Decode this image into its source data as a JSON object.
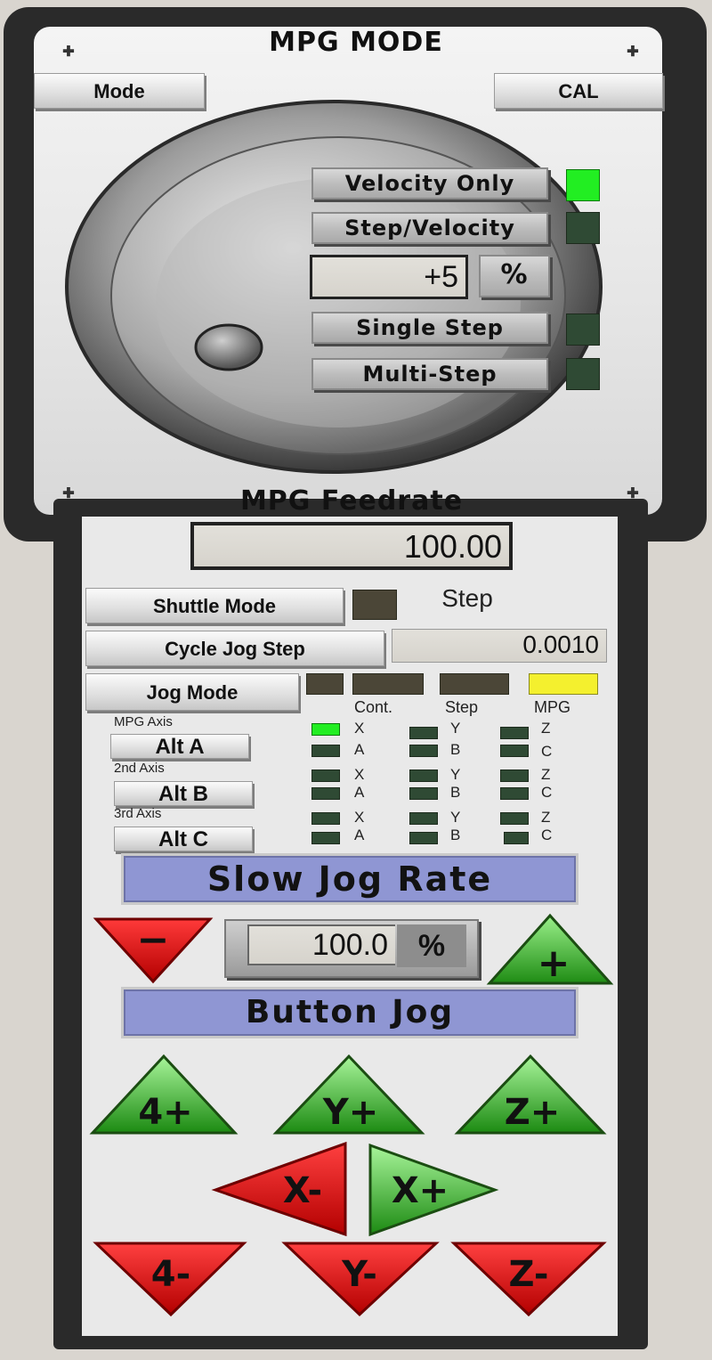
{
  "header": {
    "title": "MPG MODE",
    "mode_button": "Mode",
    "cal_button": "CAL"
  },
  "mpg_modes": [
    {
      "label": "Velocity Only",
      "active": true
    },
    {
      "label": "Step/Velocity",
      "active": false
    },
    {
      "label": "Single Step",
      "active": false
    },
    {
      "label": "Multi-Step",
      "active": false
    }
  ],
  "mpg_percent": {
    "value": "+5",
    "unit": "%"
  },
  "feedrate": {
    "title": "MPG Feedrate",
    "value": "100.00"
  },
  "shuttle": {
    "label": "Shuttle Mode",
    "status": "Step"
  },
  "jog_step": {
    "label": "Cycle Jog Step",
    "value": "0.0010"
  },
  "jog_mode": {
    "label": "Jog Mode",
    "columns": [
      "Cont.",
      "Step",
      "MPG"
    ],
    "active_column": "MPG",
    "colors": {
      "inactive": "#4b4637",
      "active": "#f4f02e"
    }
  },
  "axes": {
    "titles": [
      "MPG Axis",
      "2nd Axis",
      "3rd Axis"
    ],
    "alt_buttons": [
      "Alt A",
      "Alt B",
      "Alt C"
    ],
    "rows": [
      {
        "labels": [
          "X",
          "A",
          "Y",
          "B",
          "Z",
          "C"
        ],
        "active": "X"
      },
      {
        "labels": [
          "X",
          "A",
          "Y",
          "B",
          "Z",
          "C"
        ],
        "active": ""
      },
      {
        "labels": [
          "X",
          "A",
          "Y",
          "B",
          "Z",
          "C"
        ],
        "active": ""
      }
    ]
  },
  "slow_jog": {
    "title": "Slow Jog Rate",
    "value": "100.0",
    "unit": "%",
    "minus": "−",
    "plus": "+"
  },
  "button_jog": {
    "title": "Button Jog",
    "buttons": {
      "a_plus": "4+",
      "y_plus": "Y+",
      "z_plus": "Z+",
      "x_minus": "X-",
      "x_plus": "X+",
      "a_minus": "4-",
      "y_minus": "Y-",
      "z_minus": "Z-"
    }
  },
  "colors": {
    "green": "#3cbf2c",
    "red": "#e01212",
    "led_on": "#22ee22",
    "banner": "#8f96d3"
  }
}
